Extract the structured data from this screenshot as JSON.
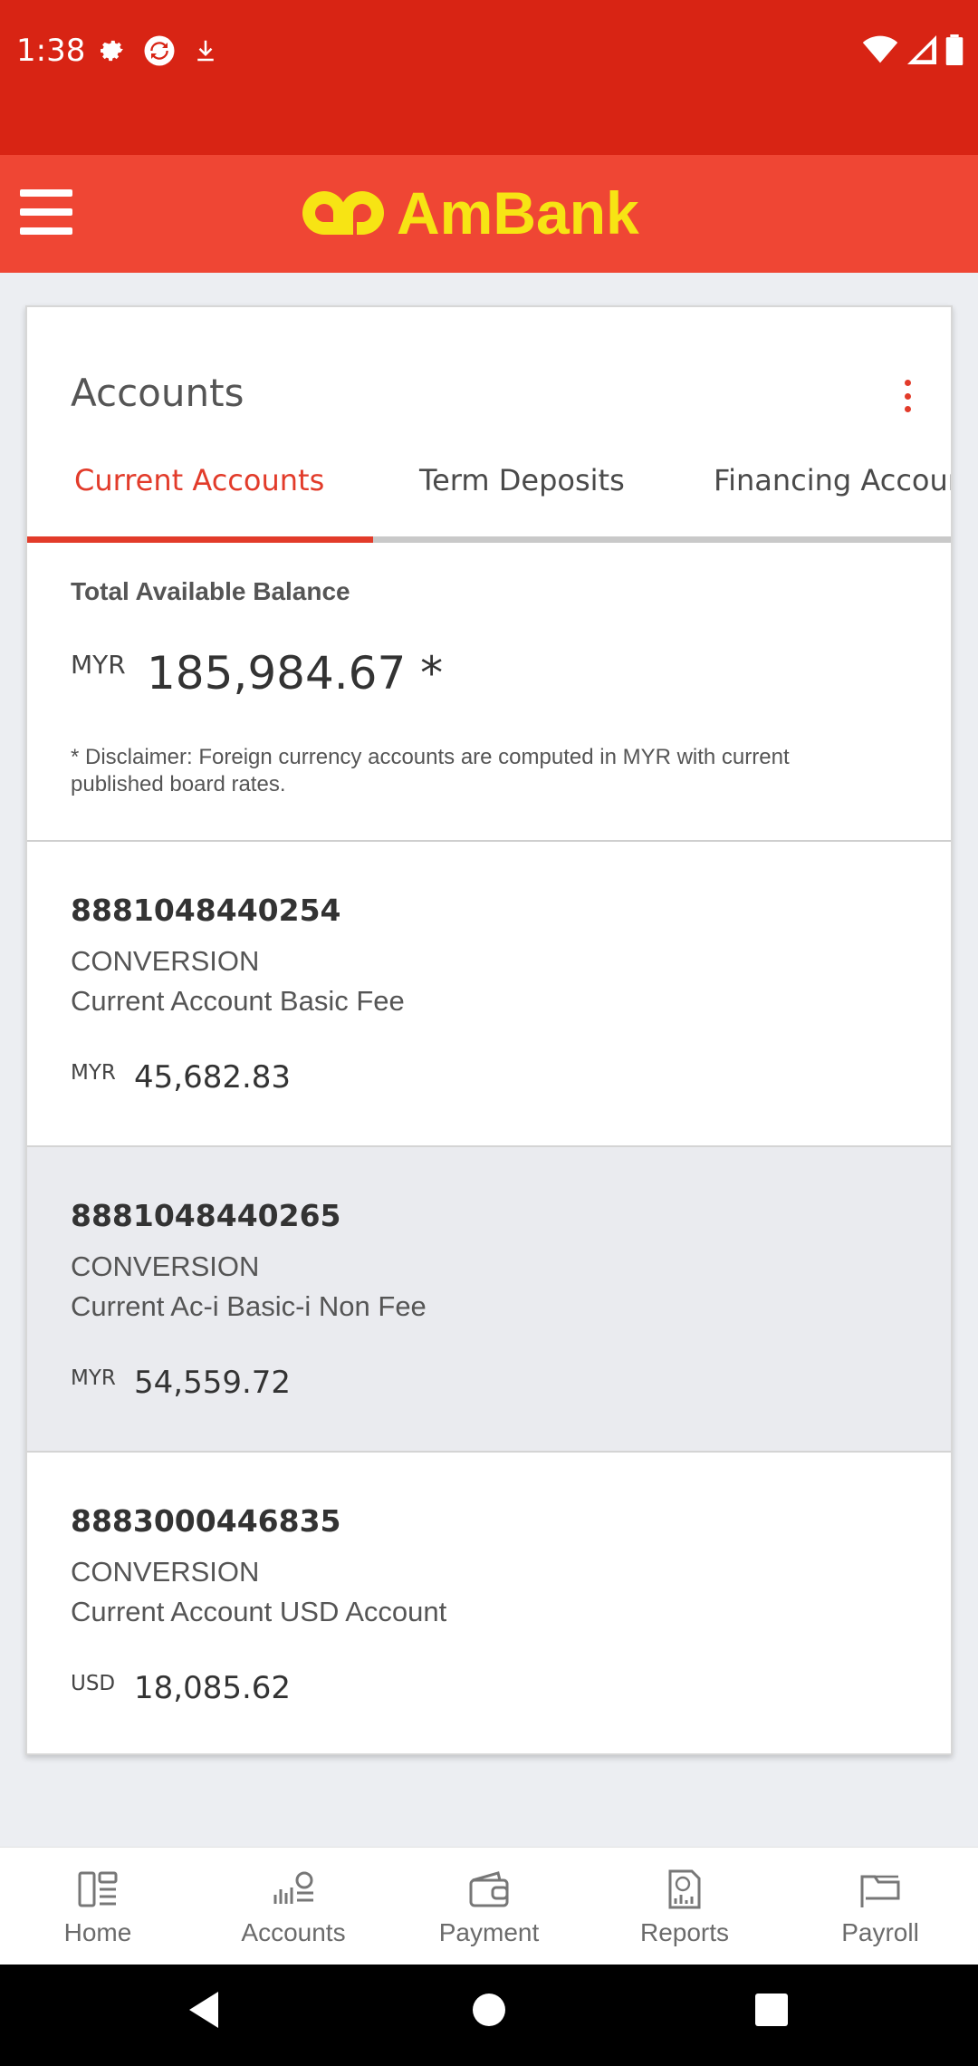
{
  "status_bar": {
    "time": "1:38"
  },
  "header": {
    "brand": "AmBank"
  },
  "card": {
    "title": "Accounts"
  },
  "tabs": [
    {
      "label": "Current Accounts"
    },
    {
      "label": "Term Deposits"
    },
    {
      "label": "Financing Accounts"
    }
  ],
  "balance": {
    "label": "Total Available Balance",
    "currency": "MYR",
    "amount": "185,984.67 *",
    "disclaimer": "* Disclaimer: Foreign currency accounts are computed in MYR with current published board rates."
  },
  "accounts": [
    {
      "number": "8881048440254",
      "type": "CONVERSION",
      "name": "Current Account Basic Fee",
      "currency": "MYR",
      "balance": "45,682.83"
    },
    {
      "number": "8881048440265",
      "type": "CONVERSION",
      "name": "Current Ac-i Basic-i Non Fee",
      "currency": "MYR",
      "balance": "54,559.72"
    },
    {
      "number": "8883000446835",
      "type": "CONVERSION",
      "name": "Current Account USD Account",
      "currency": "USD",
      "balance": "18,085.62"
    }
  ],
  "bottom_nav": [
    {
      "label": "Home",
      "icon": "home-icon"
    },
    {
      "label": "Accounts",
      "icon": "accounts-icon"
    },
    {
      "label": "Payment",
      "icon": "wallet-icon"
    },
    {
      "label": "Reports",
      "icon": "reports-icon"
    },
    {
      "label": "Payroll",
      "icon": "payroll-icon"
    }
  ],
  "colors": {
    "status_bar": "#d82414",
    "header": "#ef4634",
    "brand": "#f7e414",
    "accent": "#e23b2a"
  }
}
